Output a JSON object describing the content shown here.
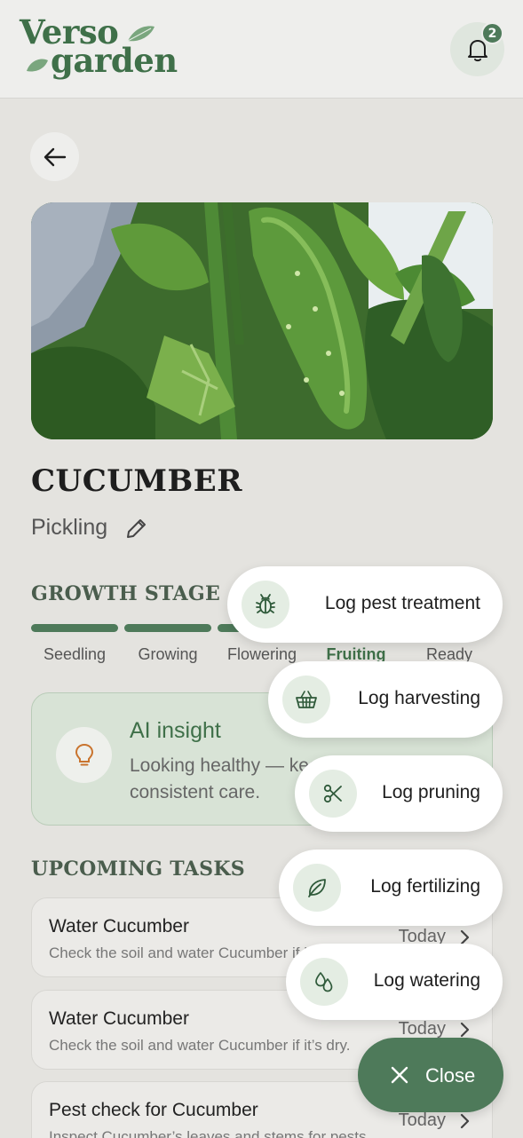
{
  "header": {
    "logo_line1": "Verso",
    "logo_line2": "garden",
    "notification_count": "2"
  },
  "plant": {
    "name": "CUCUMBER",
    "variety": "Pickling"
  },
  "growth": {
    "heading": "GROWTH STAGE",
    "stages": [
      "Seedling",
      "Growing",
      "Flowering",
      "Fruiting",
      "Ready"
    ],
    "current_stage": "Fruiting"
  },
  "insight": {
    "title": "AI insight",
    "body": "Looking healthy — keep up the consistent care."
  },
  "tasks": {
    "heading": "UPCOMING TASKS",
    "items": [
      {
        "title": "Water Cucumber",
        "desc": "Check the soil and water Cucumber if it’s dry.",
        "when": "Today"
      },
      {
        "title": "Water Cucumber",
        "desc": "Check the soil and water Cucumber if it’s dry.",
        "when": "Today"
      },
      {
        "title": "Pest check for Cucumber",
        "desc": "Inspect Cucumber’s leaves and stems for pests.",
        "when": "Today"
      }
    ]
  },
  "quick_actions": {
    "items": [
      {
        "label": "Log pest treatment",
        "icon": "bug-icon"
      },
      {
        "label": "Log harvesting",
        "icon": "basket-icon"
      },
      {
        "label": "Log pruning",
        "icon": "scissors-icon"
      },
      {
        "label": "Log fertilizing",
        "icon": "leaf-icon"
      },
      {
        "label": "Log watering",
        "icon": "droplets-icon"
      }
    ],
    "close_label": "Close"
  },
  "colors": {
    "brand_green": "#3f7049",
    "button_green": "#4e7a5a",
    "insight_bg": "#d8e3d6",
    "insight_icon": "#c9742e"
  }
}
